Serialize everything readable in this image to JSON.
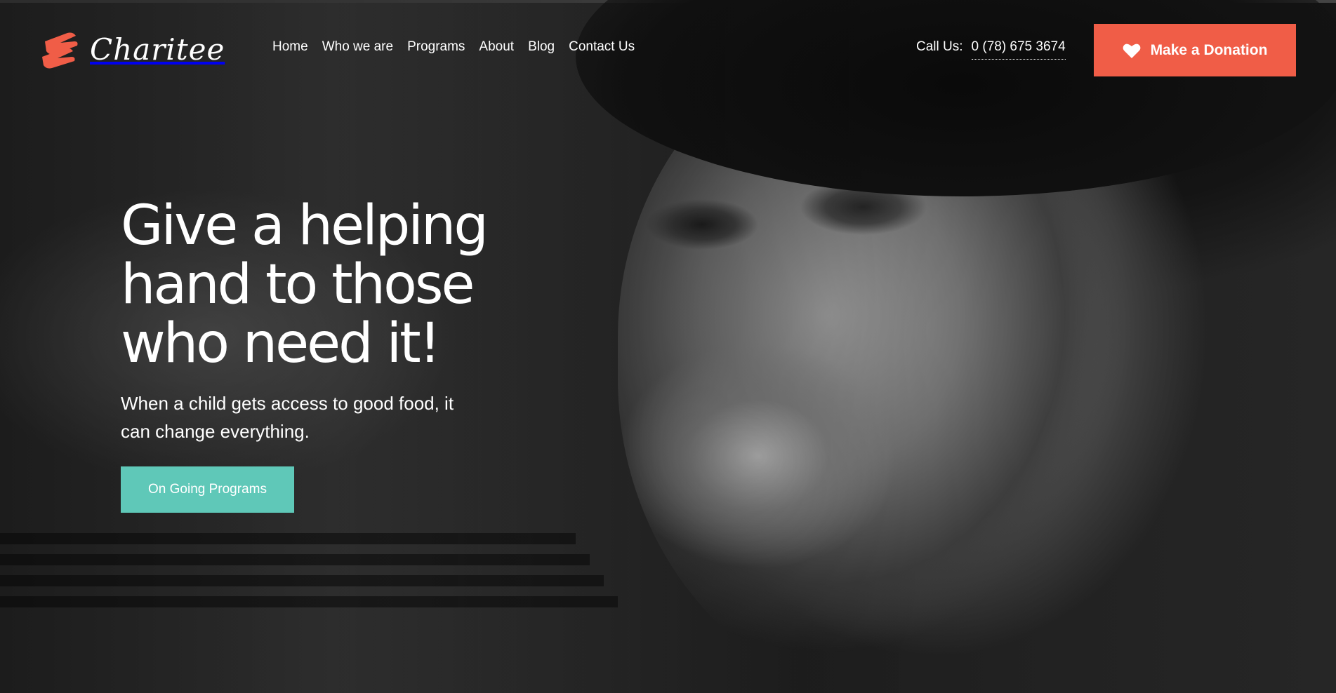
{
  "brand": {
    "name": "Charitee",
    "logo_icon": "helping-hands-icon",
    "accent_color": "#f05d47",
    "secondary_color": "#5fc8b8"
  },
  "nav": {
    "items": [
      {
        "label": "Home"
      },
      {
        "label": "Who we are"
      },
      {
        "label": "Programs"
      },
      {
        "label": "About"
      },
      {
        "label": "Blog"
      },
      {
        "label": "Contact Us"
      }
    ]
  },
  "contact": {
    "label": "Call Us:",
    "phone": "0 (78) 675 3674"
  },
  "donate_button": {
    "label": "Make a Donation",
    "icon": "heart-icon"
  },
  "hero": {
    "headline": "Give a helping hand to those who need it!",
    "subtext": "When a child gets access to good food, it can change everything.",
    "cta_label": "On Going Programs"
  }
}
